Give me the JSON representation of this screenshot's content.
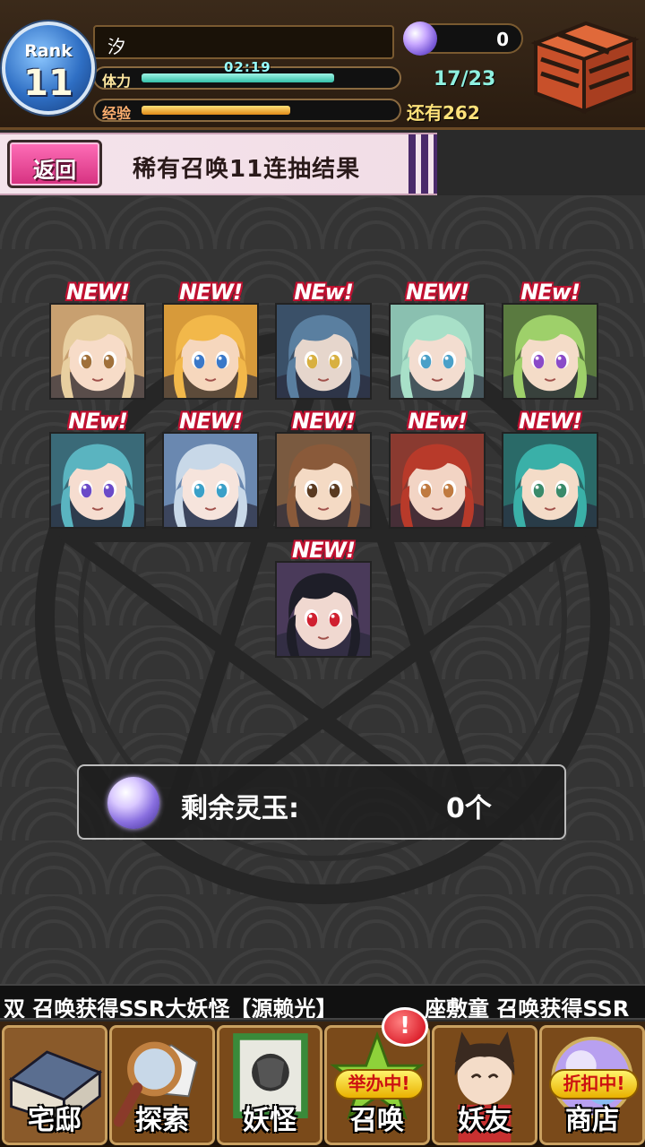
{
  "header": {
    "rank_label": "Rank",
    "rank_value": "11",
    "player_name": "汐",
    "stamina_label": "体力",
    "stamina_timer": "02:19",
    "stamina_value": "17/23",
    "exp_label": "经验",
    "exp_remaining": "还有262",
    "orb_count": "0",
    "stamina_fill": 0.74,
    "exp_fill": 0.58
  },
  "banner": {
    "back_label": "返回",
    "title": "稀有召唤11连抽结果"
  },
  "results": {
    "new_label_a": "NEW!",
    "new_label_b": "NEw!",
    "cards": [
      {
        "hair": "#e8cfa0",
        "eyes": "#a0703a",
        "skin": "#f7dcc8",
        "bg": "#c8a070",
        "tag": "NEW!"
      },
      {
        "hair": "#f2b84a",
        "eyes": "#3a78c8",
        "skin": "#f6d7bd",
        "bg": "#d79a3a",
        "tag": "NEW!"
      },
      {
        "hair": "#5a7fa0",
        "eyes": "#d8b040",
        "skin": "#e6d6cc",
        "bg": "#3a5068",
        "tag": "NEw!"
      },
      {
        "hair": "#a8e0c8",
        "eyes": "#4aa0c8",
        "skin": "#f3ddd0",
        "bg": "#8ac0b0",
        "tag": "NEW!"
      },
      {
        "hair": "#9ed06a",
        "eyes": "#8a4ac8",
        "skin": "#f4dcc8",
        "bg": "#5a7a40",
        "tag": "NEw!"
      },
      {
        "hair": "#5ab4c0",
        "eyes": "#6a4ac8",
        "skin": "#f6ddd0",
        "bg": "#3a6a78",
        "tag": "NEw!"
      },
      {
        "hair": "#c8d8e8",
        "eyes": "#3aa0c8",
        "skin": "#f6e4dc",
        "bg": "#6a88b0",
        "tag": "NEW!"
      },
      {
        "hair": "#8a5a3a",
        "eyes": "#5a3a20",
        "skin": "#f4dac4",
        "bg": "#7a5a40",
        "tag": "NEW!"
      },
      {
        "hair": "#b83a2a",
        "eyes": "#c07a40",
        "skin": "#f2d4c4",
        "bg": "#8a3a30",
        "tag": "NEw!"
      },
      {
        "hair": "#3ab0a8",
        "eyes": "#3a8a6a",
        "skin": "#f4dcc8",
        "bg": "#2a6a68",
        "tag": "NEW!"
      },
      {
        "hair": "#1e1e28",
        "eyes": "#d02030",
        "skin": "#f0d8d0",
        "bg": "#4a3a5a",
        "tag": "NEW!"
      }
    ]
  },
  "remaining": {
    "label": "剩余灵玉:",
    "value": "0个"
  },
  "ticker": {
    "msg1": "双 召唤获得SSR大妖怪【源赖光】",
    "msg2": "座敷童 召唤获得SSR"
  },
  "nav": {
    "items": [
      {
        "label": "宅邸",
        "icon": "mansion-icon"
      },
      {
        "label": "探索",
        "icon": "magnifier-icon"
      },
      {
        "label": "妖怪",
        "icon": "scroll-icon"
      },
      {
        "label": "召唤",
        "icon": "summon-star-icon",
        "badge": "举办中!"
      },
      {
        "label": "妖友",
        "icon": "catgirl-icon"
      },
      {
        "label": "商店",
        "icon": "shop-orb-icon",
        "badge": "折扣中!"
      }
    ],
    "alert": "!"
  },
  "colors": {
    "accent_pink": "#e0408f",
    "stamina": "#35c0a8",
    "exp": "#e08a18",
    "new_tag": "#c01030"
  }
}
